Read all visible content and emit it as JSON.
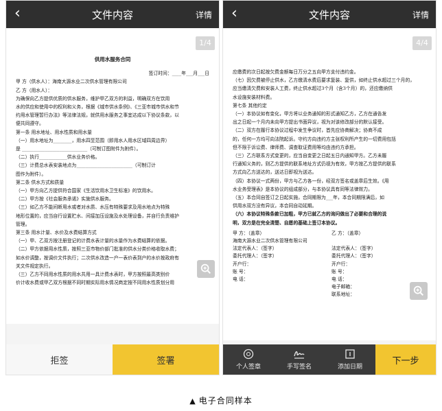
{
  "left_phone": {
    "back_icon": "chevron-left-icon",
    "title": "文件内容",
    "detail": "详情",
    "page_badge": "1/4",
    "doc": {
      "heading": "供用水服务合同",
      "sign_time": "签订时间：____年___月___日",
      "lines": [
        "甲 方（供水人）：海南大源水业二次供水管理有限公司",
        "乙 方（用水人）：",
        "    为确保向乙方提供优质的供水服务，维护甲乙双方的利益，明确双方在饮用",
        "水的供应和使用中的权利和义务，根据《城市供水条例》、《三亚市城市供水和节",
        "约用水管理暂行办法》等法律法规，就供用水服务之事宜达成以下协议条款，以",
        "便共同遵守。",
        "    第一条  用水地址、用水性质和用水量",
        "    （一）用水地址为________，用水四至范围（即用水人用水区域四周边界）",
        "是 ____________________________（可制订图附件为附件）。",
        "    （二）执行____________供水业务价格。",
        "    （三）计费总水表安装地点为________________________（可制订计",
        "图作为附件）。",
        "    第二条  供水方式和质量",
        "    （一）甲方向乙方提供符合国家《生活饮用水卫生标准》的饮用水。",
        "    （二）甲方按《社会服务承诺》实施供水服务。",
        "    （三）如乙方不能间断用水或者对水质、水压有特殊要求及用水地点为特殊",
        "地形位置的，应当自行设置贮水、间接加压设施及水处理设备，并自行负责维护",
        "管理。",
        "    第三条  用水计量、水价及水费结算方式",
        "    （一）甲、乙双方按注册登记的计费水表计量的水量作为水费结算的依据。",
        "    （二）甲方依据用水性质，按照三亚市物价部门批准的供水分类价格收取水费；",
        "如水价调整，按调价文件执行；二次供水改造一户一表价表到户的水价按政府有",
        "关文件规定执行。",
        "    （三）乙方不同用水性质的用水共用一具计费水表时，甲方按照最高类别价",
        "价计收水费或甲乙双方根据不同时期实际用水情况商定按不同用水性质划分用"
      ]
    },
    "zoom_icon": "zoom-in-icon",
    "reject_label": "拒签",
    "sign_label": "签署"
  },
  "right_phone": {
    "back_icon": "chevron-left-icon",
    "title": "文件内容",
    "detail": "详情",
    "page_badge": "4/4",
    "doc": {
      "lines_top": [
        "应缴费的次日起按欠费金额每日万分之五向甲方支付违约金。",
        "    （七）因欠费被停止供水，乙方缴清水费后要求复装、复供，如终止供水超过三个月的，",
        "应当缴清欠费和安装人工费，终止供水超过3个月（含3个月）的，还应缴纳供",
        "水设施安装材料费。",
        "    第七条  其他约定",
        "    （一）本协议如有变化，甲方将以业务通知的形式通知乙方，乙方在通告发",
        "出之日起一个月内未向甲方提出书面异议，视为对该修改部分的默认接受。",
        "    （二）双方在履行本协议过程中发生争议时，首先应协商解决；协商不成",
        "的，任何一方均可向法院起诉。守约方向违约方主张权利所产生的一切费用包括",
        "但不限于诉讼费、律师费、调查取证费用等均由违约方承担。",
        "    （三）乙方联系方式变更的，应当自变更之日起五日内通知甲方。乙方未履",
        "行通知义务的，则乙方提供的联系地址方式仍视为有效，甲方按乙方提供的联系",
        "方式向乙方送达的，送达日即视为送达。",
        "    （四）本协议一式两份，甲方与乙方各一份，经双方签名或盖章后生效。《用",
        "水业务受理表》是本协议的组成部分，与本协议具有同等法律效力。",
        "    （五）本合同自签订之日起实施，合同期限为___年，本合同期限满后，如",
        "供用水双方没有异议，本合同自动延期。"
      ],
      "bold_lines": [
        "    （六）本协议特殊条款已加粗，甲方已就乙方的询问做出了必要和合理的说",
        "明，双方是在完全清楚、自愿的基础上签订本协议。"
      ],
      "party_a_header": "甲  方：（盖章）",
      "party_b_header": "乙  方：（盖章）",
      "party_a_name": "海南大源水业二次供水管理有限公司",
      "rows_a": [
        "法定代表人：（签字）",
        "委托代理人：（签字）",
        "开户行：",
        "账    号：",
        "电    话："
      ],
      "rows_b": [
        "法定代表人：（签字）",
        "委托代理人：（签字）",
        "开户行：",
        "账    号：",
        "电    话：",
        "电子邮箱：",
        "联系地址："
      ]
    },
    "zoom_icon": "zoom-in-icon",
    "tools": [
      {
        "label": "个人签章",
        "icon": "stamp-icon"
      },
      {
        "label": "手写签名",
        "icon": "handwriting-icon"
      },
      {
        "label": "添加日期",
        "icon": "calendar-icon"
      }
    ],
    "next_label": "下一步"
  },
  "caption": {
    "marker": "▲",
    "text": "电子合同样本"
  }
}
